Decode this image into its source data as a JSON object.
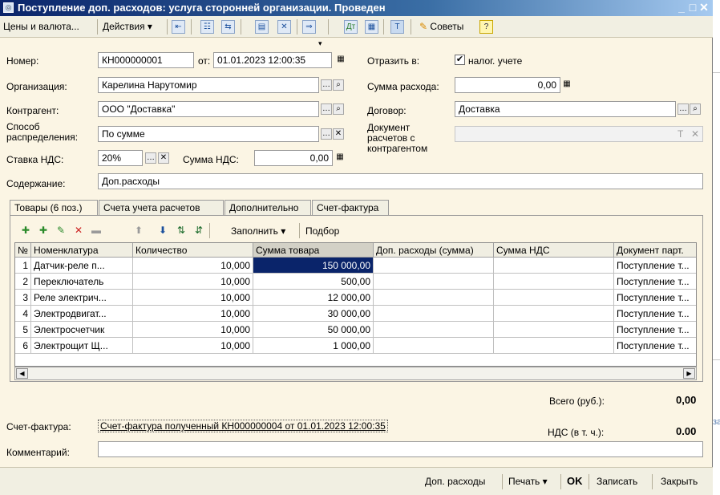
{
  "window": {
    "title": "Поступление доп. расходов: услуга сторонней организации. Проведен",
    "minimize_glyph": "_",
    "maximize_glyph": "□",
    "close_glyph": "✕"
  },
  "toolbar": {
    "prices_currency": "Цены и валюта...",
    "actions": "Действия",
    "advice": "Советы",
    "help": "?"
  },
  "form": {
    "number_label": "Номер:",
    "number_value": "КН000000001",
    "date_label": "от:",
    "date_value": "01.01.2023 12:00:35",
    "reflect_label": "Отразить в:",
    "reflect_tax_label": "налог. учете",
    "org_label": "Организация:",
    "org_value": "Карелина Нарутомир",
    "expense_sum_label": "Сумма расхода:",
    "expense_sum_value": "0,00",
    "counterparty_label": "Контрагент:",
    "counterparty_value": "ООО \"Доставка\"",
    "contract_label": "Договор:",
    "contract_value": "Доставка",
    "distribution_label_1": "Способ",
    "distribution_label_2": "распределения:",
    "distribution_value": "По сумме",
    "settlement_doc_label_1": "Документ",
    "settlement_doc_label_2": "расчетов с",
    "settlement_doc_label_3": "контрагентом",
    "vat_rate_label": "Ставка НДС:",
    "vat_rate_value": "20%",
    "vat_sum_label": "Сумма НДС:",
    "vat_sum_value": "0,00",
    "content_label": "Содержание:",
    "content_value": "Доп.расходы"
  },
  "tabs": [
    {
      "label": "Товары (6 поз.)"
    },
    {
      "label": "Счета учета расчетов"
    },
    {
      "label": "Дополнительно"
    },
    {
      "label": "Счет-фактура"
    }
  ],
  "table_toolbar": {
    "fill": "Заполнить",
    "select": "Подбор"
  },
  "table": {
    "columns": [
      "№",
      "Номенклатура",
      "Количество",
      "Сумма товара",
      "Доп. расходы (сумма)",
      "Сумма НДС",
      "Документ парт."
    ],
    "rows": [
      {
        "n": "1",
        "name": "Датчик-реле п...",
        "qty": "10,000",
        "sum": "150 000,00",
        "extra": "",
        "vat": "",
        "doc": "Поступление т..."
      },
      {
        "n": "2",
        "name": "Переключатель",
        "qty": "10,000",
        "sum": "500,00",
        "extra": "",
        "vat": "",
        "doc": "Поступление т..."
      },
      {
        "n": "3",
        "name": "Реле электрич...",
        "qty": "10,000",
        "sum": "12 000,00",
        "extra": "",
        "vat": "",
        "doc": "Поступление т..."
      },
      {
        "n": "4",
        "name": "Электродвигат...",
        "qty": "10,000",
        "sum": "30 000,00",
        "extra": "",
        "vat": "",
        "doc": "Поступление т..."
      },
      {
        "n": "5",
        "name": "Электросчетчик",
        "qty": "10,000",
        "sum": "50 000,00",
        "extra": "",
        "vat": "",
        "doc": "Поступление т..."
      },
      {
        "n": "6",
        "name": "Электрощит Щ...",
        "qty": "10,000",
        "sum": "1 000,00",
        "extra": "",
        "vat": "",
        "doc": "Поступление т..."
      }
    ]
  },
  "totals": {
    "total_label": "Всего (руб.):",
    "total_value": "0,00",
    "vat_label": "НДС (в т. ч.):",
    "vat_value": "0.00"
  },
  "invoice": {
    "label": "Счет-фактура:",
    "link": "Счет-фактура полученный КН000000004 от 01.01.2023 12:00:35"
  },
  "comment": {
    "label": "Комментарий:",
    "value": ""
  },
  "bottom": {
    "extra_expenses": "Доп. расходы",
    "print": "Печать",
    "ok": "OK",
    "save": "Записать",
    "close": "Закрыть"
  }
}
